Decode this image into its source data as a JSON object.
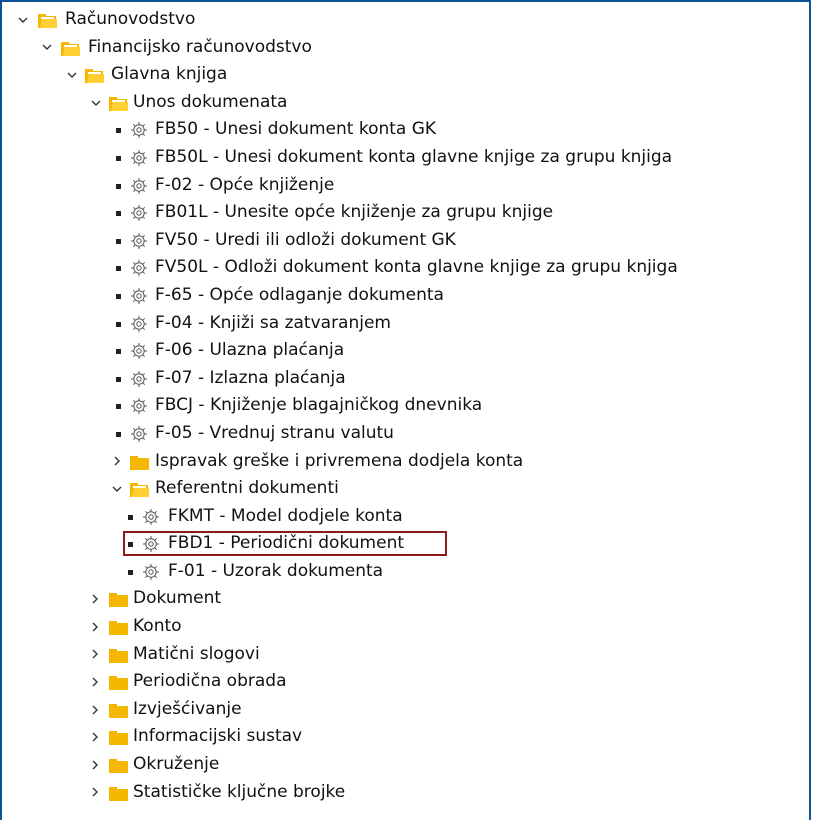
{
  "tree": {
    "root": {
      "label": "Računovodstvo",
      "expanded": true
    },
    "fin": {
      "label": "Financijsko računovodstvo",
      "expanded": true
    },
    "gk": {
      "label": "Glavna knjiga",
      "expanded": true
    },
    "unos": {
      "label": "Unos dokumenata",
      "expanded": true,
      "items": [
        "FB50 - Unesi dokument konta GK",
        "FB50L - Unesi dokument konta glavne knjige za grupu knjiga",
        "F-02 - Opće knjiženje",
        "FB01L - Unesite opće knjiženje za grupu knjige",
        "FV50 - Uredi ili odloži dokument GK",
        "FV50L - Odloži dokument konta glavne knjige za grupu knjiga",
        "F-65 - Opće odlaganje dokumenta",
        "F-04 - Knjiži sa zatvaranjem",
        "F-06 - Ulazna plaćanja",
        "F-07 - Izlazna plaćanja",
        "FBCJ - Knjiženje blagajničkog dnevnika",
        "F-05 - Vrednuj stranu valutu"
      ]
    },
    "ispravak": {
      "label": "Ispravak greške i privremena dodjela konta",
      "expanded": false
    },
    "referentni": {
      "label": "Referentni dokumenti",
      "expanded": true,
      "items": [
        "FKMT - Model dodjele konta",
        "FBD1 - Periodični dokument",
        "F-01 - Uzorak dokumenta"
      ],
      "highlighted_item": "FBD1 - Periodični dokument"
    },
    "collapsed": [
      "Dokument",
      "Konto",
      "Matični slogovi",
      "Periodična obrada",
      "Izvješćivanje",
      "Informacijski sustav",
      "Okruženje",
      "Statističke ključne brojke"
    ]
  },
  "icons": {
    "expanded_toggle": "chevron-down-icon",
    "collapsed_toggle": "chevron-right-icon",
    "open_folder": "folder-open-icon",
    "closed_folder": "folder-closed-icon",
    "transaction": "gear-icon"
  },
  "colors": {
    "frame_border": "#0b5394",
    "folder": "#f5b800",
    "highlight_border": "#8b1a1a"
  }
}
